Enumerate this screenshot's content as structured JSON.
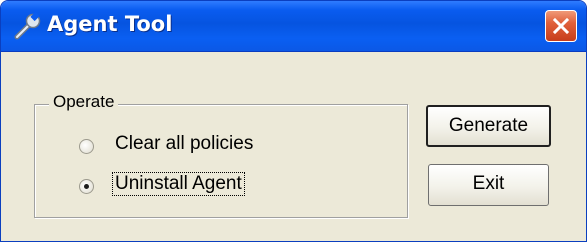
{
  "window": {
    "title": "Agent Tool",
    "icon": "wrench-icon",
    "close_icon": "close-icon"
  },
  "group": {
    "label": "Operate",
    "options": [
      {
        "label": "Clear all policies",
        "selected": false
      },
      {
        "label": "Uninstall Agent",
        "selected": true,
        "focused": true
      }
    ]
  },
  "buttons": {
    "generate": "Generate",
    "exit": "Exit"
  },
  "colors": {
    "title_bar": "#0654e0",
    "dialog_bg": "#ece9d8",
    "close_button": "#e0603a"
  }
}
